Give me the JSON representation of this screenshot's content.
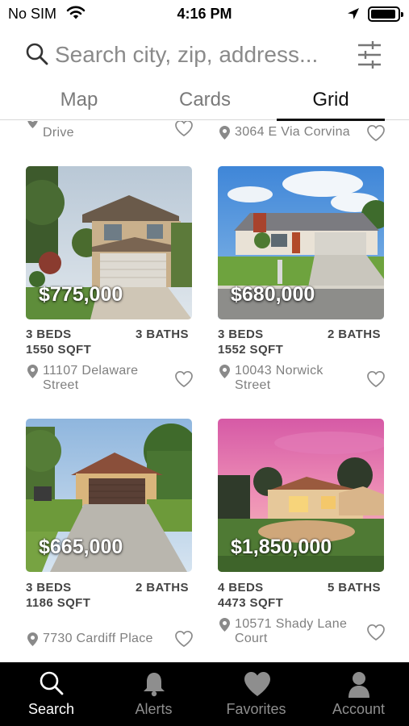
{
  "status_bar": {
    "carrier": "No SIM",
    "time": "4:16 PM"
  },
  "search": {
    "placeholder": "Search city, zip, address..."
  },
  "tabs": [
    {
      "label": "Map",
      "active": false
    },
    {
      "label": "Cards",
      "active": false
    },
    {
      "label": "Grid",
      "active": true
    }
  ],
  "partial_row": [
    {
      "address_line1": "",
      "address_line2": "Drive"
    },
    {
      "address_line1": "3064 E Via Corvina",
      "address_line2": ""
    }
  ],
  "listings": [
    {
      "price": "$775,000",
      "beds": "3 BEDS",
      "baths": "3 BATHS",
      "sqft": "1550 SQFT",
      "address_line1": "11107 Delaware",
      "address_line2": "Street"
    },
    {
      "price": "$680,000",
      "beds": "3 BEDS",
      "baths": "2 BATHS",
      "sqft": "1552 SQFT",
      "address_line1": "10043 Norwick",
      "address_line2": "Street"
    },
    {
      "price": "$665,000",
      "beds": "3 BEDS",
      "baths": "2 BATHS",
      "sqft": "1186 SQFT",
      "address_line1": "7730 Cardiff Place",
      "address_line2": ""
    },
    {
      "price": "$1,850,000",
      "beds": "4 BEDS",
      "baths": "5 BATHS",
      "sqft": "4473 SQFT",
      "address_line1": "10571 Shady Lane",
      "address_line2": "Court"
    }
  ],
  "bottom_nav": [
    {
      "label": "Search",
      "icon": "search-icon",
      "active": true
    },
    {
      "label": "Alerts",
      "icon": "bell-icon",
      "active": false
    },
    {
      "label": "Favorites",
      "icon": "heart-icon",
      "active": false
    },
    {
      "label": "Account",
      "icon": "person-icon",
      "active": false
    }
  ],
  "colors": {
    "tab_bar_bg": "#000000",
    "active_nav": "#ffffff",
    "inactive_nav": "#8e8e8e",
    "text_secondary": "#7f7f7f"
  }
}
